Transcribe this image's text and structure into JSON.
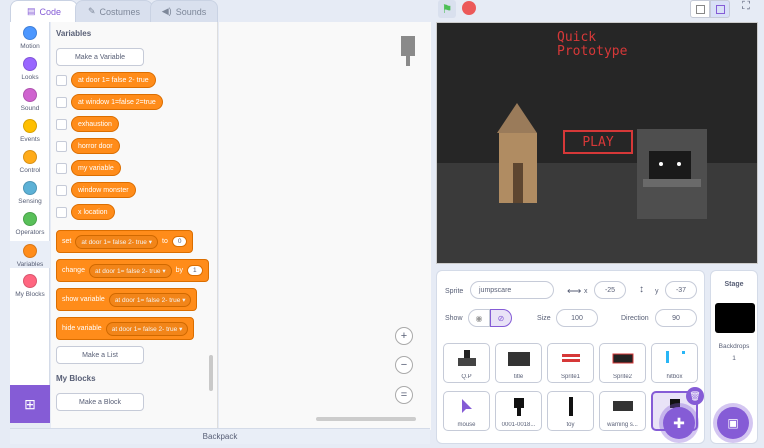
{
  "tabs": {
    "code": "Code",
    "costumes": "Costumes",
    "sounds": "Sounds"
  },
  "categories": [
    {
      "label": "Motion",
      "color": "#4c97ff"
    },
    {
      "label": "Looks",
      "color": "#9966ff"
    },
    {
      "label": "Sound",
      "color": "#cf63cf"
    },
    {
      "label": "Events",
      "color": "#ffbf00"
    },
    {
      "label": "Control",
      "color": "#ffab19"
    },
    {
      "label": "Sensing",
      "color": "#5cb1d6"
    },
    {
      "label": "Operators",
      "color": "#59c059"
    },
    {
      "label": "Variables",
      "color": "#ff8c1a"
    },
    {
      "label": "My Blocks",
      "color": "#ff6680"
    }
  ],
  "palette": {
    "variables_heading": "Variables",
    "make_variable": "Make a Variable",
    "variables": [
      "at door 1= false 2- true",
      "at window 1=false 2=true",
      "exhaustion",
      "horror door",
      "my variable",
      "window monster",
      "x location"
    ],
    "set_block": {
      "keyword": "set",
      "var": "at door 1= false 2- true",
      "to": "to",
      "value": "0"
    },
    "change_block": {
      "keyword": "change",
      "var": "at door 1= false 2- true",
      "by": "by",
      "value": "1"
    },
    "show_block": {
      "keyword": "show variable",
      "var": "at door 1= false 2- true"
    },
    "hide_block": {
      "keyword": "hide variable",
      "var": "at door 1= false 2- true"
    },
    "make_list": "Make a List",
    "myblocks_heading": "My Blocks",
    "make_block": "Make a Block"
  },
  "backpack": "Backpack",
  "stage": {
    "title": "Quick\nPrototype",
    "play": "PLAY"
  },
  "sprite_info": {
    "sprite_label": "Sprite",
    "sprite_name": "jumpscare",
    "x_label": "x",
    "x": "-25",
    "y_label": "y",
    "y": "-37",
    "show_label": "Show",
    "size_label": "Size",
    "size": "100",
    "direction_label": "Direction",
    "direction": "90"
  },
  "sprites": [
    "Q.P",
    "title",
    "Sprite1",
    "Sprite2",
    "hitbox",
    "mouse",
    "0001-0018...",
    "toy",
    "warning s...",
    "ju"
  ],
  "stage_pane": {
    "label": "Stage",
    "backdrops_label": "Backdrops",
    "backdrops_count": "1"
  },
  "accent": "#855cd6"
}
